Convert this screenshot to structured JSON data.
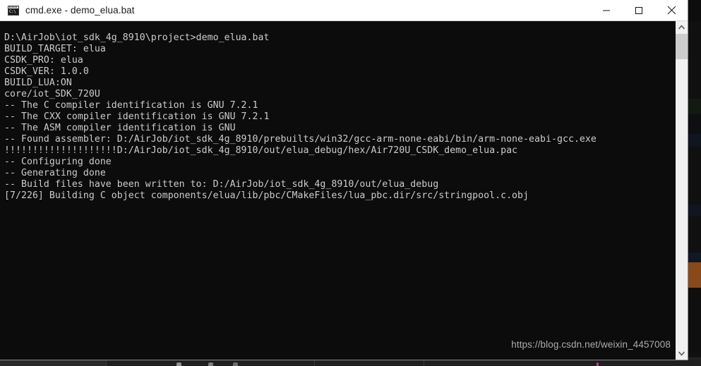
{
  "window": {
    "title": "cmd.exe - demo_elua.bat",
    "app_icon": "cmd-console-icon",
    "icon_caption": "C:\\",
    "controls": {
      "minimize_label": "Minimize",
      "maximize_label": "Maximize",
      "close_label": "Close"
    }
  },
  "console": {
    "prompt_line": "D:\\AirJob\\iot_sdk_4g_8910\\project>demo_elua.bat",
    "lines": [
      "D:\\AirJob\\iot_sdk_4g_8910\\project>demo_elua.bat",
      "BUILD_TARGET: elua",
      "CSDK_PRO: elua",
      "CSDK_VER: 1.0.0",
      "BUILD_LUA:ON",
      "core/iot_SDK_720U",
      "-- The C compiler identification is GNU 7.2.1",
      "-- The CXX compiler identification is GNU 7.2.1",
      "-- The ASM compiler identification is GNU",
      "-- Found assembler: D:/AirJob/iot_sdk_4g_8910/prebuilts/win32/gcc-arm-none-eabi/bin/arm-none-eabi-gcc.exe",
      "!!!!!!!!!!!!!!!!!!!!D:/AirJob/iot_sdk_4g_8910/out/elua_debug/hex/Air720U_CSDK_demo_elua.pac",
      "-- Configuring done",
      "-- Generating done",
      "-- Build files have been written to: D:/AirJob/iot_sdk_4g_8910/out/elua_debug",
      "[7/226] Building C object components/elua/lib/pbc/CMakeFiles/lua_pbc.dir/src/stringpool.c.obj"
    ],
    "build_progress": "[7/226]",
    "foreground_color": "#cccccc",
    "background_color": "#0c0c0c"
  },
  "watermark": {
    "text": "https://blog.csdn.net/weixin_4457008"
  },
  "scrollbar": {
    "up_arrow": "chevron-up-icon",
    "down_arrow": "chevron-down-icon"
  }
}
